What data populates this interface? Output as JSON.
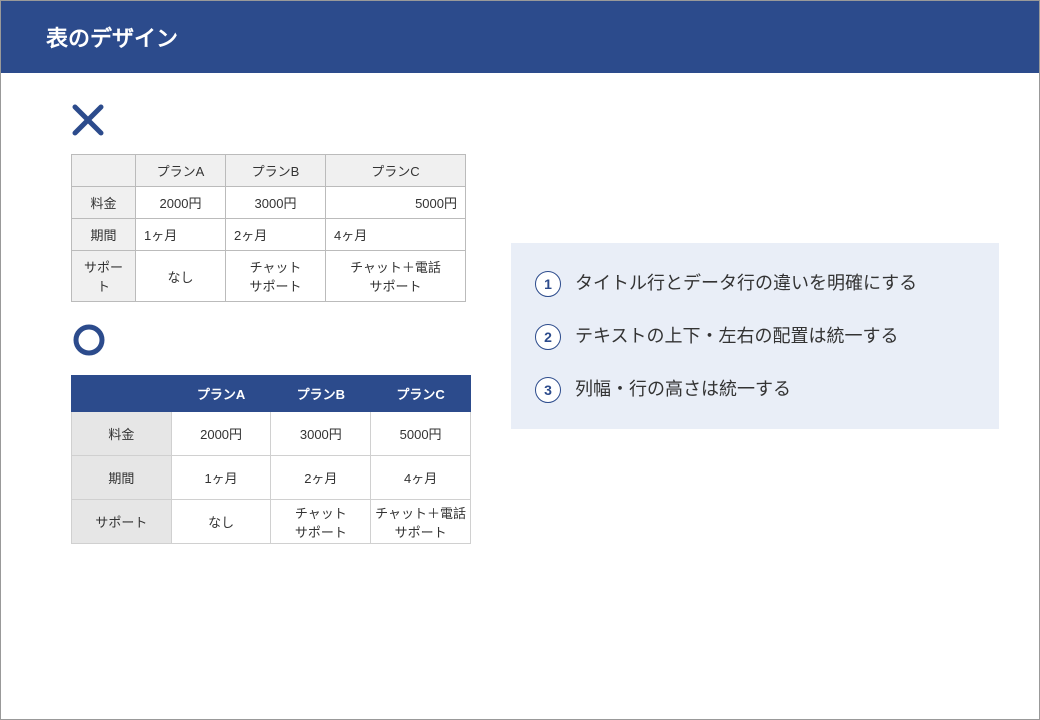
{
  "header": {
    "title": "表のデザイン"
  },
  "icons": {
    "bad": "✕",
    "good": "◯"
  },
  "bad_table": {
    "columns": [
      "",
      "プランA",
      "プランB",
      "プランC"
    ],
    "row_headers": [
      "料金",
      "期間",
      "サポート"
    ],
    "rows": [
      [
        "2000円",
        "3000円",
        "5000円"
      ],
      [
        "1ヶ月",
        "2ヶ月",
        "4ヶ月"
      ],
      [
        "なし",
        "チャット\nサポート",
        "チャット＋電話\nサポート"
      ]
    ]
  },
  "good_table": {
    "columns": [
      "",
      "プランA",
      "プランB",
      "プランC"
    ],
    "row_headers": [
      "料金",
      "期間",
      "サポート"
    ],
    "rows": [
      [
        "2000円",
        "3000円",
        "5000円"
      ],
      [
        "1ヶ月",
        "2ヶ月",
        "4ヶ月"
      ],
      [
        "なし",
        "チャット\nサポート",
        "チャット＋電話\nサポート"
      ]
    ]
  },
  "tips": [
    {
      "num": "1",
      "text": "タイトル行とデータ行の違いを明確にする"
    },
    {
      "num": "2",
      "text": "テキストの上下・左右の配置は統一する"
    },
    {
      "num": "3",
      "text": "列幅・行の高さは統一する"
    }
  ],
  "colors": {
    "accent": "#2c4b8c",
    "panel": "#e9eef7"
  }
}
